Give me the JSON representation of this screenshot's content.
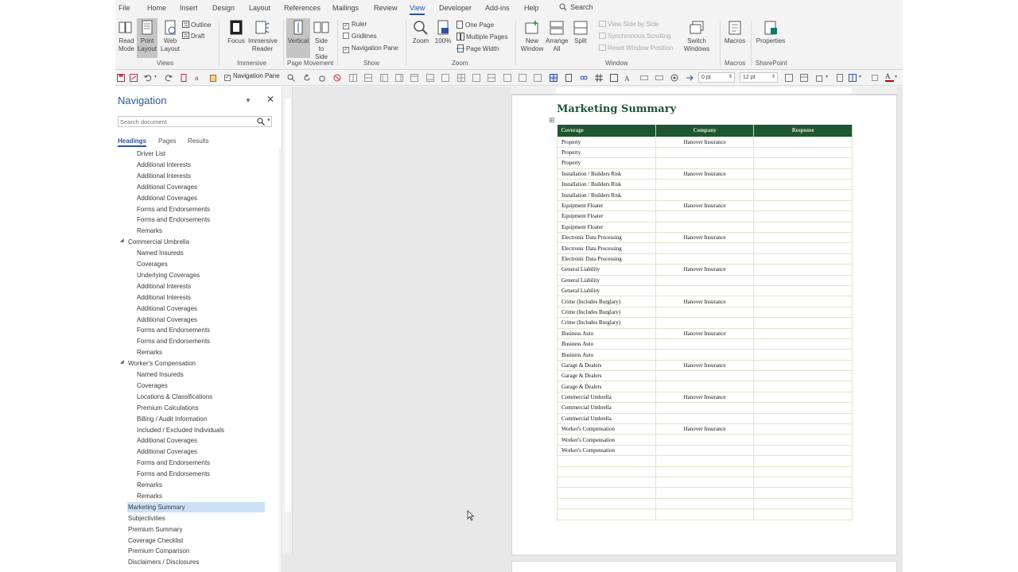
{
  "menu": {
    "tabs": [
      "File",
      "Home",
      "Insert",
      "Design",
      "Layout",
      "References",
      "Mailings",
      "Review",
      "View",
      "Developer",
      "Add-ins",
      "Help"
    ],
    "active": "View",
    "search": "Search"
  },
  "ribbon": {
    "views": {
      "read_mode": "Read Mode",
      "print_layout": "Print Layout",
      "web_layout": "Web Layout",
      "outline": "Outline",
      "draft": "Draft",
      "label": "Views"
    },
    "immersive": {
      "focus": "Focus",
      "immersive_reader": "Immersive Reader",
      "label": "Immersive"
    },
    "page_movement": {
      "vertical": "Vertical",
      "side_to_side": "Side to Side",
      "label": "Page Movement"
    },
    "show": {
      "ruler": "Ruler",
      "gridlines": "Gridlines",
      "navigation_pane": "Navigation Pane",
      "ruler_checked": true,
      "gridlines_checked": false,
      "navigation_pane_checked": true,
      "label": "Show"
    },
    "zoom": {
      "zoom": "Zoom",
      "hundred": "100%",
      "one_page": "One Page",
      "multiple_pages": "Multiple Pages",
      "page_width": "Page Width",
      "label": "Zoom"
    },
    "window": {
      "new_window": "New Window",
      "arrange_all": "Arrange All",
      "split": "Split",
      "view_side_by_side": "View Side by Side",
      "synchronous_scrolling": "Synchronous Scrolling",
      "reset_window_position": "Reset Window Position",
      "switch_windows": "Switch Windows",
      "label": "Window"
    },
    "macros": {
      "macros": "Macros",
      "label": "Macros"
    },
    "sharepoint": {
      "properties": "Properties",
      "label": "SharePoint"
    }
  },
  "toolbar": {
    "navigation_pane": "Navigation Pane",
    "spacing_before": "0 pt",
    "spacing_after": "12 pt",
    "accent_red": "#c00000"
  },
  "navigation": {
    "title": "Navigation",
    "search_placeholder": "Search document",
    "tabs": [
      "Headings",
      "Pages",
      "Results"
    ],
    "active_tab": "Headings",
    "items": [
      {
        "label": "Driver List",
        "level": 2
      },
      {
        "label": "Additional Interests",
        "level": 2
      },
      {
        "label": "Additional Interests",
        "level": 2
      },
      {
        "label": "Additional Coverages",
        "level": 2
      },
      {
        "label": "Additional Coverages",
        "level": 2
      },
      {
        "label": "Forms and Endorsements",
        "level": 2
      },
      {
        "label": "Forms and Endorsements",
        "level": 2
      },
      {
        "label": "Remarks",
        "level": 2
      },
      {
        "label": "Commercial Umbrella",
        "level": 1,
        "expanded": true
      },
      {
        "label": "Named Insureds",
        "level": 2
      },
      {
        "label": "Coverages",
        "level": 2
      },
      {
        "label": "Underlying Coverages",
        "level": 2
      },
      {
        "label": "Additional Interests",
        "level": 2
      },
      {
        "label": "Additional Interests",
        "level": 2
      },
      {
        "label": "Additional Coverages",
        "level": 2
      },
      {
        "label": "Additional Coverages",
        "level": 2
      },
      {
        "label": "Forms and Endorsements",
        "level": 2
      },
      {
        "label": "Forms and Endorsements",
        "level": 2
      },
      {
        "label": "Remarks",
        "level": 2
      },
      {
        "label": "Worker's Compensation",
        "level": 1,
        "expanded": true
      },
      {
        "label": "Named Insureds",
        "level": 2
      },
      {
        "label": "Coverages",
        "level": 2
      },
      {
        "label": "Locations & Classifications",
        "level": 2
      },
      {
        "label": "Premium Calculations",
        "level": 2
      },
      {
        "label": "Billing / Audit Information",
        "level": 2
      },
      {
        "label": "Included / Excluded Individuals",
        "level": 2
      },
      {
        "label": "Additional Coverages",
        "level": 2
      },
      {
        "label": "Additional Coverages",
        "level": 2
      },
      {
        "label": "Forms and Endorsements",
        "level": 2
      },
      {
        "label": "Forms and Endorsements",
        "level": 2
      },
      {
        "label": "Remarks",
        "level": 2
      },
      {
        "label": "Remarks",
        "level": 2
      },
      {
        "label": "Marketing Summary",
        "level": 1,
        "selected": true
      },
      {
        "label": "Subjectivities",
        "level": 1
      },
      {
        "label": "Premium Summary",
        "level": 1
      },
      {
        "label": "Coverage Checklist",
        "level": 1
      },
      {
        "label": "Premium Comparison",
        "level": 1
      },
      {
        "label": "Disclaimers / Disclosures",
        "level": 1
      }
    ]
  },
  "document": {
    "title": "Marketing Summary",
    "headers": [
      "Coverage",
      "Company",
      "Response"
    ],
    "rows": [
      [
        "Property",
        "Hanover Insurance",
        ""
      ],
      [
        "Property",
        "",
        ""
      ],
      [
        "Property",
        "",
        ""
      ],
      [
        "Installation / Builders Risk",
        "Hanover Insurance",
        ""
      ],
      [
        "Installation / Builders Risk",
        "",
        ""
      ],
      [
        "Installation / Builders Risk",
        "",
        ""
      ],
      [
        "Equipment Floater",
        "Hanover Insurance",
        ""
      ],
      [
        "Equipment Floater",
        "",
        ""
      ],
      [
        "Equipment Floater",
        "",
        ""
      ],
      [
        "Electronic Data Processing",
        "Hanover Insurance",
        ""
      ],
      [
        "Electronic Data Processing",
        "",
        ""
      ],
      [
        "Electronic Data Processing",
        "",
        ""
      ],
      [
        "General Liability",
        "Hanover Insurance",
        ""
      ],
      [
        "General Liability",
        "",
        ""
      ],
      [
        "General Liability",
        "",
        ""
      ],
      [
        "Crime (Includes Burglary)",
        "Hanover Insurance",
        ""
      ],
      [
        "Crime (Includes Burglary)",
        "",
        ""
      ],
      [
        "Crime (Includes Burglary)",
        "",
        ""
      ],
      [
        "Business Auto",
        "Hanover Insurance",
        ""
      ],
      [
        "Business Auto",
        "",
        ""
      ],
      [
        "Business Auto",
        "",
        ""
      ],
      [
        "Garage & Dealers",
        "Hanover Insurance",
        ""
      ],
      [
        "Garage & Dealers",
        "",
        ""
      ],
      [
        "Garage & Dealers",
        "",
        ""
      ],
      [
        "Commercial Umbrella",
        "Hanover Insurance",
        ""
      ],
      [
        "Commercial Umbrella",
        "",
        ""
      ],
      [
        "Commercial Umbrella",
        "",
        ""
      ],
      [
        "Worker's Compensation",
        "Hanover Insurance",
        ""
      ],
      [
        "Worker's Compensation",
        "",
        ""
      ],
      [
        "Worker's Compensation",
        "",
        ""
      ],
      [
        "",
        "",
        ""
      ],
      [
        "",
        "",
        ""
      ],
      [
        "",
        "",
        ""
      ],
      [
        "",
        "",
        ""
      ],
      [
        "",
        "",
        ""
      ],
      [
        "",
        "",
        ""
      ]
    ],
    "header_color": "#1e5631",
    "title_color": "#1e5631"
  }
}
